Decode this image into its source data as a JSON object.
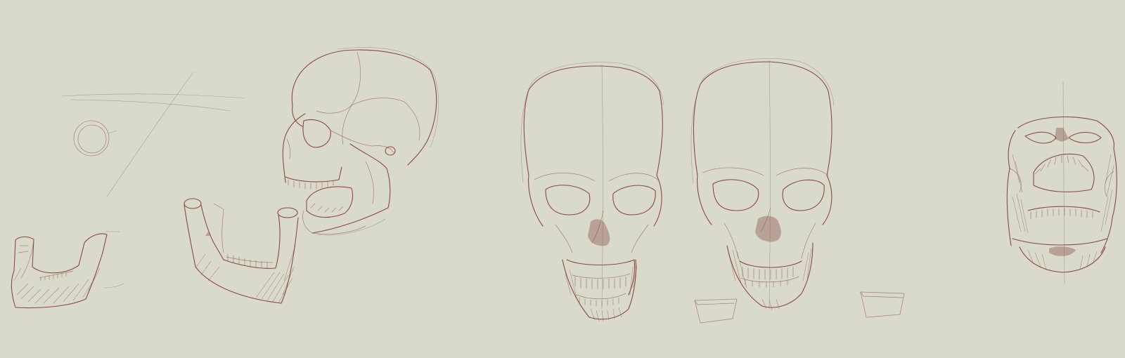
{
  "canvas": {
    "background": "#d9d9cc",
    "ink_color": "#8c4a42"
  },
  "sketches": [
    {
      "name": "guide-lines-and-circle"
    },
    {
      "name": "mandible-small-left"
    },
    {
      "name": "mandible-large"
    },
    {
      "name": "skull-three-quarter-open-jaw"
    },
    {
      "name": "skull-front-open-jaw"
    },
    {
      "name": "skull-front-closed-jaw"
    },
    {
      "name": "skull-underside-view"
    }
  ]
}
